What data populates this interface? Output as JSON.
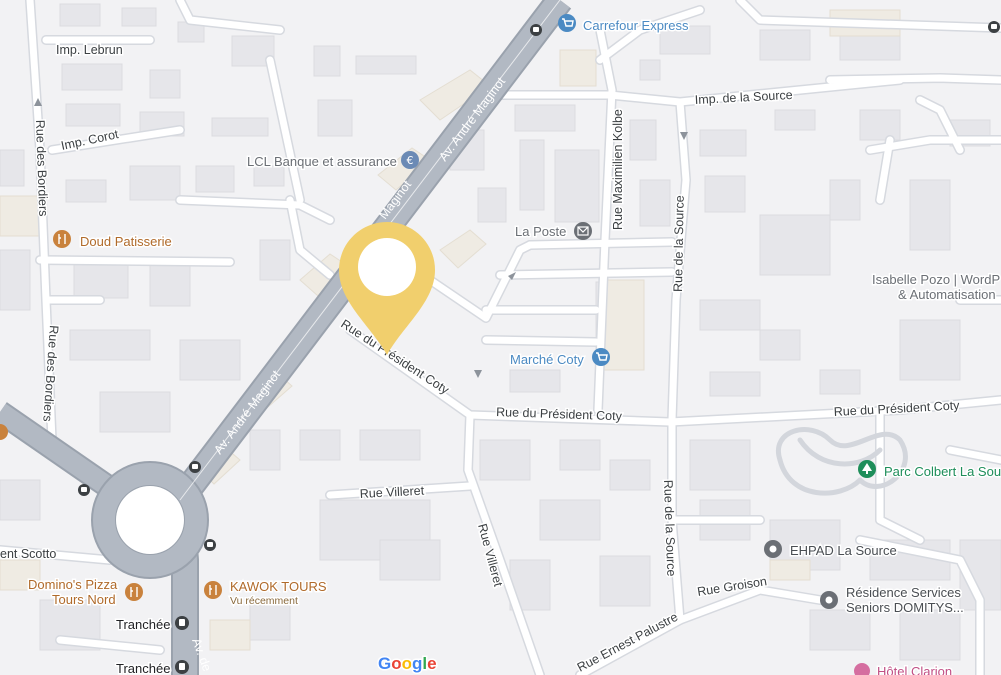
{
  "colors": {
    "background": "#f2f2f4",
    "road": "#ffffff",
    "main_road": "#b2b9c3",
    "marker": "#f1cf6d",
    "poi_blue": "#4b8ac3",
    "poi_food": "#c9823d",
    "poi_park": "#1e8e5a",
    "poi_gray": "#6b6f75",
    "poi_pink": "#d56ea0"
  },
  "streets": {
    "imp_lebrun": "Imp. Lebrun",
    "imp_corot": "Imp. Corot",
    "rue_des_bordiers": "Rue des Bordiers",
    "av_maginot_top": "Av. André Maginot",
    "av_maginot_mid": "Av. André Maginot",
    "av_maginot_fragment": "Maginot",
    "av_maginot_bottom": "Av. de",
    "rue_maximilien_kolbe": "Rue Maximilien Kolbe",
    "imp_de_la_source": "Imp. de la Source",
    "rue_de_la_source_top": "Rue de la Source",
    "rue_de_la_source_bottom": "Rue de la Source",
    "rue_president_coty_diag": "Rue du Président Coty",
    "rue_president_coty_mid": "Rue du Président Coty",
    "rue_president_coty_right": "Rue du Président Coty",
    "rue_villeret_h": "Rue Villeret",
    "rue_villeret_v": "Rue Villeret",
    "rue_groison": "Rue Groison",
    "rue_ernest_palustre": "Rue Ernest Palustre",
    "scotto_fragment": "ent Scotto"
  },
  "pois": {
    "carrefour": {
      "name": "Carrefour Express",
      "icon": "cart-icon"
    },
    "lcl": {
      "name": "LCL Banque et assurance",
      "icon": "euro-icon"
    },
    "doud": {
      "name": "Doud Patisserie",
      "icon": "fork-knife-icon"
    },
    "la_poste": {
      "name": "La Poste",
      "icon": "mail-icon"
    },
    "isabelle_line1": "Isabelle Pozo | WordP",
    "isabelle_line2": "& Automatisation",
    "marche_coty": {
      "name": "Marché Coty",
      "icon": "cart-icon"
    },
    "parc_colbert": {
      "name": "Parc Colbert La Sou",
      "icon": "tree-icon"
    },
    "ehpad": {
      "name": "EHPAD La Source",
      "icon": "dot-icon"
    },
    "residence_line1": "Résidence Services",
    "residence_line2": "Seniors DOMITYS...",
    "dominos_line1": "Domino's Pizza",
    "dominos_line2": "Tours Nord",
    "kawok": {
      "name": "KAWOK TOURS",
      "sub": "Vu récemment",
      "icon": "fork-knife-icon"
    },
    "tranchee_1": "Tranchée",
    "tranchee_2": "Tranchée",
    "hotel": "Hôtel Clarion"
  },
  "google_logo": [
    "G",
    "o",
    "o",
    "g",
    "l",
    "e"
  ]
}
